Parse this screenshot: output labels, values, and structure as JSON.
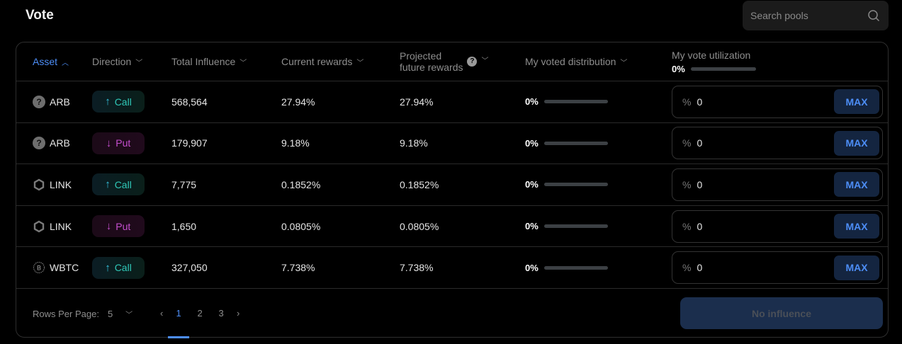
{
  "header": {
    "title": "Vote",
    "search_placeholder": "Search pools"
  },
  "columns": {
    "asset": "Asset",
    "direction": "Direction",
    "total_influence": "Total Influence",
    "current_rewards": "Current rewards",
    "projected_line1": "Projected",
    "projected_line2": "future rewards",
    "my_voted_distribution": "My voted distribution",
    "my_vote_utilization": "My vote utilization",
    "utilization_value": "0%",
    "utilization_fraction": 0
  },
  "rows": [
    {
      "asset": "ARB",
      "icon": "question-icon",
      "direction": "Call",
      "total_influence": "568,564",
      "current_rewards": "27.94%",
      "projected": "27.94%",
      "distribution": "0%",
      "vote": "0"
    },
    {
      "asset": "ARB",
      "icon": "question-icon",
      "direction": "Put",
      "total_influence": "179,907",
      "current_rewards": "9.18%",
      "projected": "9.18%",
      "distribution": "0%",
      "vote": "0"
    },
    {
      "asset": "LINK",
      "icon": "chainlink-icon",
      "direction": "Call",
      "total_influence": "7,775",
      "current_rewards": "0.1852%",
      "projected": "0.1852%",
      "distribution": "0%",
      "vote": "0"
    },
    {
      "asset": "LINK",
      "icon": "chainlink-icon",
      "direction": "Put",
      "total_influence": "1,650",
      "current_rewards": "0.0805%",
      "projected": "0.0805%",
      "distribution": "0%",
      "vote": "0"
    },
    {
      "asset": "WBTC",
      "icon": "bitcoin-icon",
      "direction": "Call",
      "total_influence": "327,050",
      "current_rewards": "7.738%",
      "projected": "7.738%",
      "distribution": "0%",
      "vote": "0"
    }
  ],
  "input": {
    "percent_symbol": "%",
    "max_label": "MAX"
  },
  "footer": {
    "rows_per_page_label": "Rows Per Page:",
    "rows_per_page": "5",
    "pages": [
      "1",
      "2",
      "3"
    ],
    "current_page": "1",
    "prev": "‹",
    "next": "›",
    "submit_label": "No influence"
  },
  "colors": {
    "accent": "#4d8ef7",
    "call": "#2fc8b8",
    "put": "#c54fcf"
  }
}
